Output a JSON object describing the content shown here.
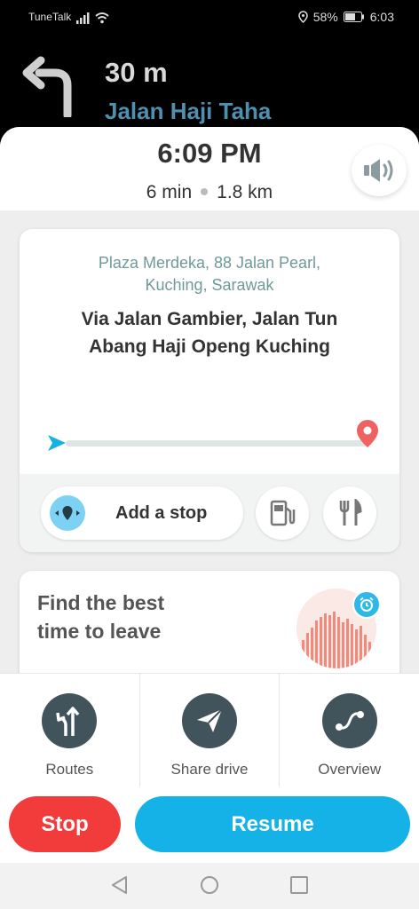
{
  "status_bar": {
    "carrier": "TuneTalk",
    "battery": "58%",
    "time": "6:03"
  },
  "instruction": {
    "distance": "30 m",
    "street": "Jalan Haji Taha",
    "icon": "turn-left-icon"
  },
  "eta": {
    "arrival_time": "6:09 PM",
    "duration": "6 min",
    "distance": "1.8 km"
  },
  "destination": {
    "address_line1": "Plaza Merdeka, 88 Jalan Pearl,",
    "address_line2": "Kuching, Sarawak",
    "via_line1": "Via Jalan Gambier, Jalan Tun",
    "via_line2": "Abang Haji Openg Kuching",
    "progress": 0.0,
    "add_stop_label": "Add a stop"
  },
  "leave_card": {
    "title_line1": "Find the best",
    "title_line2": "time to leave"
  },
  "actions": [
    {
      "label": "Routes",
      "icon": "routes-icon"
    },
    {
      "label": "Share drive",
      "icon": "share-drive-icon"
    },
    {
      "label": "Overview",
      "icon": "overview-icon"
    }
  ],
  "buttons": {
    "stop": "Stop",
    "resume": "Resume"
  },
  "colors": {
    "accent_blue": "#14b2e6",
    "stop_red": "#f23c3c",
    "street_blue": "#4f8fb0",
    "action_circle": "#41535b"
  }
}
